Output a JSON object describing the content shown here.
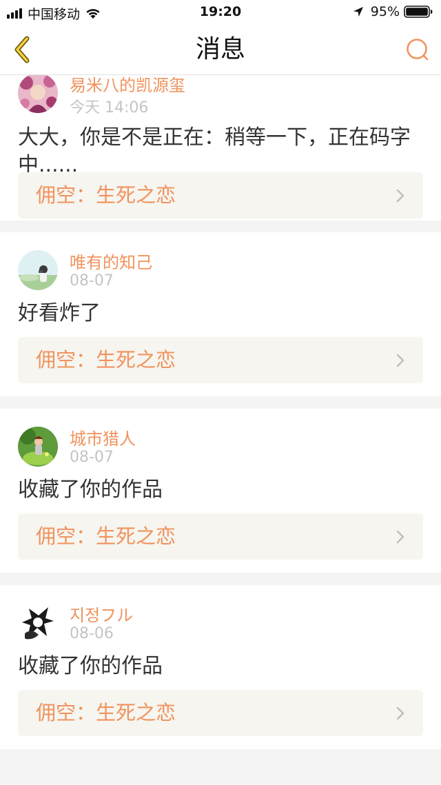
{
  "status_bar": {
    "carrier": "中国移动",
    "time": "19:20",
    "battery": "95%"
  },
  "nav": {
    "title": "消息",
    "accent": "#f0935d"
  },
  "messages": [
    {
      "user": "易米八的凯源玺",
      "time": "今天 14:06",
      "text": "大大，你是不是正在：稍等一下，正在码字中......",
      "work": "佣空：生死之恋"
    },
    {
      "user": "唯有的知己",
      "time": "08-07",
      "text": "好看炸了",
      "work": "佣空：生死之恋"
    },
    {
      "user": "城市猎人",
      "time": "08-07",
      "text": "收藏了你的作品",
      "work": "佣空：生死之恋"
    },
    {
      "user": "지정フル",
      "time": "08-06",
      "text": "收藏了你的作品",
      "work": "佣空：生死之恋"
    }
  ],
  "icons": {
    "back": "chevron-left-icon",
    "search": "search-icon",
    "wifi": "wifi-icon",
    "location": "location-arrow-icon",
    "battery": "battery-icon",
    "row_arrow": "chevron-right-icon"
  }
}
